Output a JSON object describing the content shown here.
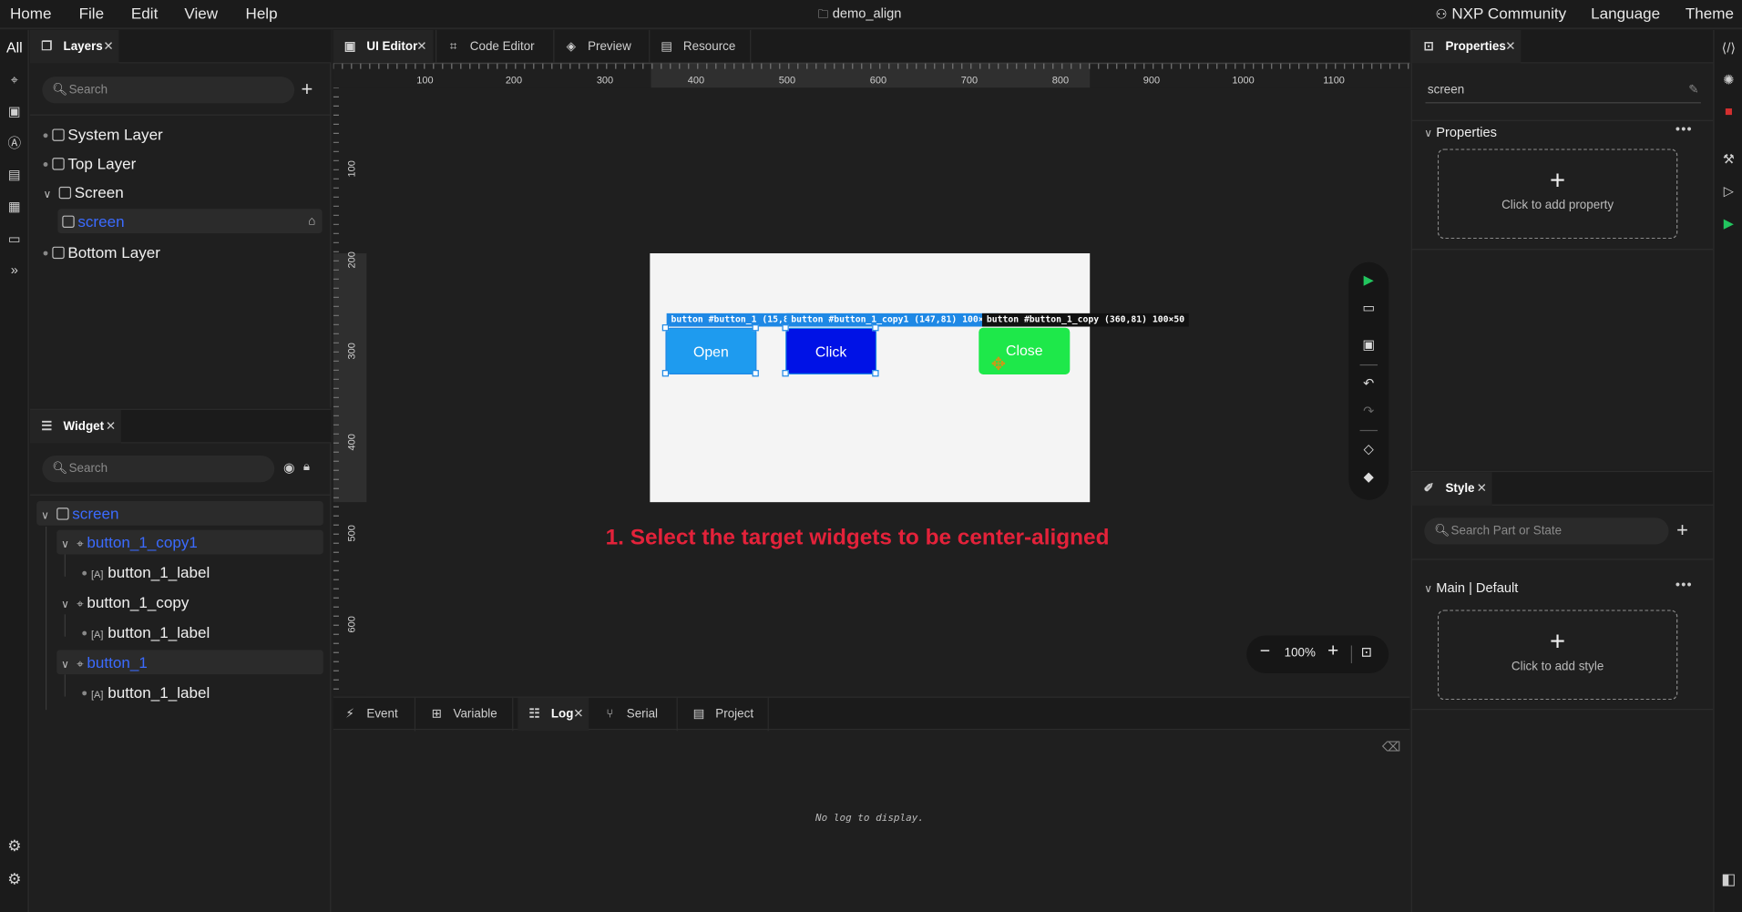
{
  "menubar": {
    "items": [
      "Home",
      "File",
      "Edit",
      "View",
      "Help"
    ],
    "window_title": "demo_align",
    "right_items": [
      "NXP Community",
      "Language",
      "Theme"
    ]
  },
  "left_rail": {
    "all_label": "All"
  },
  "layers_panel": {
    "tab_label": "Layers",
    "search_placeholder": "Search",
    "rows": [
      {
        "label": "System Layer"
      },
      {
        "label": "Top Layer"
      },
      {
        "label": "Screen"
      },
      {
        "label": "screen"
      },
      {
        "label": "Bottom Layer"
      }
    ]
  },
  "widget_panel": {
    "tab_label": "Widget",
    "search_placeholder": "Search",
    "rows": [
      {
        "label": "screen"
      },
      {
        "label": "button_1_copy1"
      },
      {
        "label": "button_1_label"
      },
      {
        "label": "button_1_copy"
      },
      {
        "label": "button_1_label"
      },
      {
        "label": "button_1"
      },
      {
        "label": "button_1_label"
      }
    ]
  },
  "editor_tabs": [
    "UI Editor",
    "Code Editor",
    "Preview",
    "Resource"
  ],
  "ruler": {
    "h_labels": [
      "100",
      "200",
      "300",
      "400",
      "500",
      "600",
      "700",
      "800",
      "900",
      "1000",
      "1100"
    ],
    "v_labels": [
      "100",
      "200",
      "300",
      "400",
      "500",
      "600"
    ]
  },
  "canvas": {
    "buttons": [
      {
        "label": "Open",
        "color": "#1e9bef"
      },
      {
        "label": "Click",
        "color": "#0012e6"
      },
      {
        "label": "Close",
        "color": "#1ee84a"
      }
    ],
    "tags": [
      "button #button_1 (15,81",
      "button #button_1_copy1 (147,81) 100×50",
      "button #button_1_copy (360,81) 100×50"
    ],
    "selection_color": "#1e88e5"
  },
  "instruction": {
    "text": "1. Select the target widgets to be center-aligned",
    "color": "#e3223a"
  },
  "zoom": {
    "value": "100%"
  },
  "bottom_tabs": [
    "Event",
    "Variable",
    "Log",
    "Serial",
    "Project"
  ],
  "log": {
    "empty_text": "No log to display."
  },
  "properties_panel": {
    "tab_label": "Properties",
    "screen_field": "screen",
    "section_title": "Properties",
    "add_label": "Click to add property"
  },
  "style_panel": {
    "tab_label": "Style",
    "search_placeholder": "Search Part or State",
    "section_title": "Main | Default",
    "add_label": "Click to add style"
  }
}
